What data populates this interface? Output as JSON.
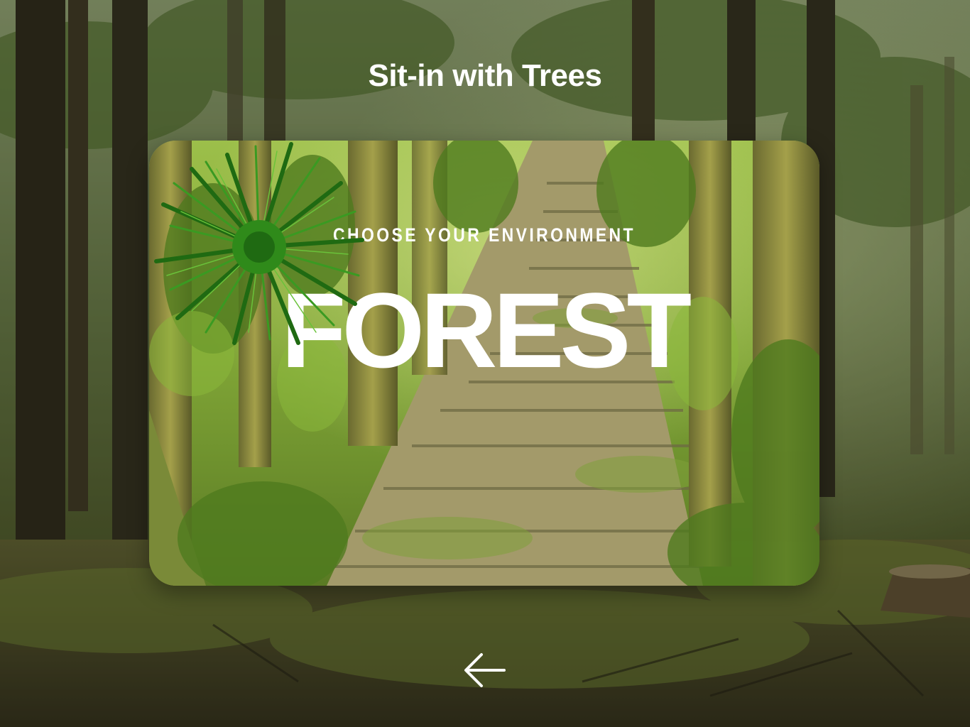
{
  "app": {
    "title": "Sit-in with Trees"
  },
  "card": {
    "eyebrow": "CHOOSE YOUR ENVIRONMENT",
    "environment_name": "FOREST"
  },
  "navigation": {
    "back_icon": "arrow-left-icon"
  },
  "colors": {
    "text": "#ffffff",
    "forest_dark": "#2f3a22",
    "forest_green": "#6f9a2e",
    "plant_green": "#2f8a1a"
  }
}
